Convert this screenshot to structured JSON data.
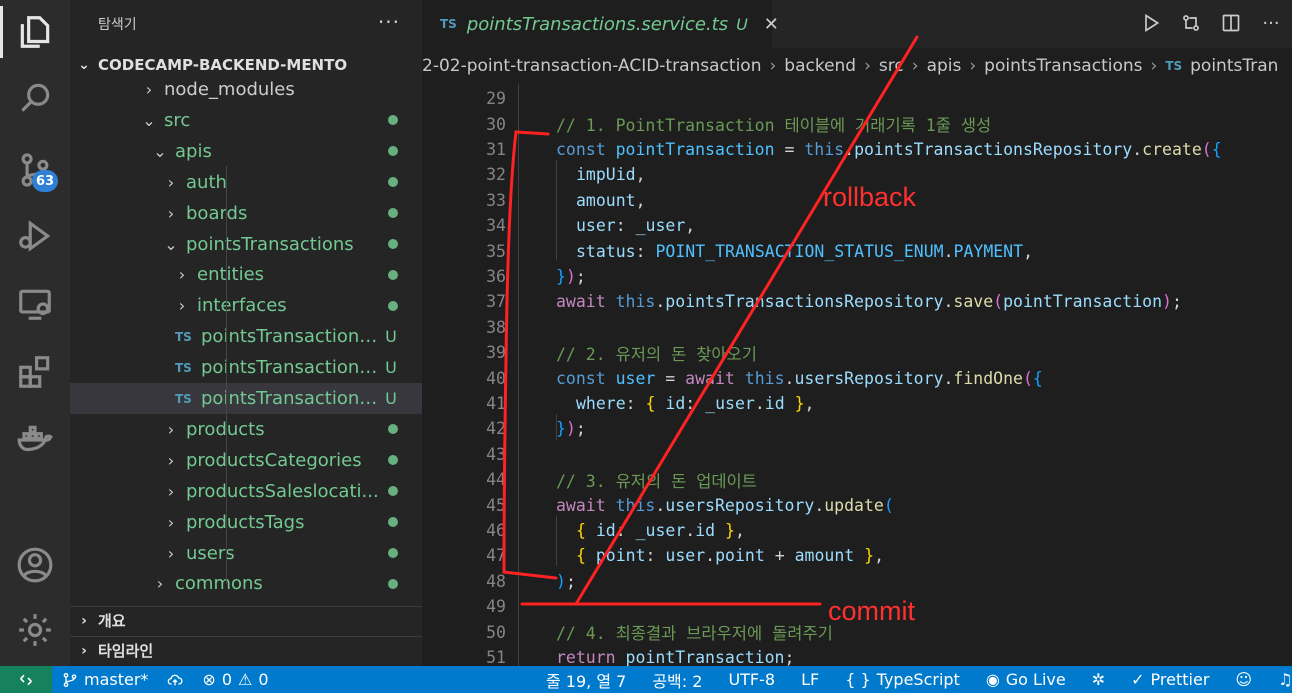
{
  "activity_bar": {
    "items": [
      {
        "name": "explorer",
        "icon": "files-icon",
        "active": true
      },
      {
        "name": "search",
        "icon": "search-icon"
      },
      {
        "name": "source-control",
        "icon": "source-control-icon",
        "badge": "63"
      },
      {
        "name": "run-debug",
        "icon": "run-debug-icon"
      },
      {
        "name": "remote-explorer",
        "icon": "remote-explorer-icon"
      },
      {
        "name": "extensions",
        "icon": "extensions-icon"
      },
      {
        "name": "docker",
        "icon": "docker-icon"
      }
    ],
    "bottom": [
      {
        "name": "accounts",
        "icon": "account-icon"
      },
      {
        "name": "manage",
        "icon": "gear-icon"
      }
    ]
  },
  "sidebar": {
    "title": "탐색기",
    "more": "···",
    "root_label": "CODECAMP-BACKEND-MENTO",
    "tree": [
      {
        "label": "node_modules",
        "chev": "›",
        "level": 1,
        "plain": true
      },
      {
        "label": "src",
        "chev": "⌄",
        "level": 1,
        "dot": true
      },
      {
        "label": "apis",
        "chev": "⌄",
        "level": 2,
        "dot": true
      },
      {
        "label": "auth",
        "chev": "›",
        "level": 3,
        "dot": true
      },
      {
        "label": "boards",
        "chev": "›",
        "level": 3,
        "dot": true
      },
      {
        "label": "pointsTransactions",
        "chev": "⌄",
        "level": 3,
        "dot": true
      },
      {
        "label": "entities",
        "chev": "›",
        "level": 4,
        "dot": true
      },
      {
        "label": "interfaces",
        "chev": "›",
        "level": 4,
        "dot": true
      },
      {
        "label": "pointsTransactions....",
        "ts": "TS",
        "level": 4,
        "mark": "U"
      },
      {
        "label": "pointsTransactions....",
        "ts": "TS",
        "level": 4,
        "mark": "U"
      },
      {
        "label": "pointsTransactions....",
        "ts": "TS",
        "level": 4,
        "mark": "U",
        "selected": true
      },
      {
        "label": "products",
        "chev": "›",
        "level": 3,
        "dot": true
      },
      {
        "label": "productsCategories",
        "chev": "›",
        "level": 3,
        "dot": true
      },
      {
        "label": "productsSaleslocati...",
        "chev": "›",
        "level": 3,
        "dot": true
      },
      {
        "label": "productsTags",
        "chev": "›",
        "level": 3,
        "dot": true
      },
      {
        "label": "users",
        "chev": "›",
        "level": 3,
        "dot": true
      },
      {
        "label": "commons",
        "chev": "›",
        "level": 2,
        "dot": true
      }
    ],
    "outline_label": "개요",
    "timeline_label": "타임라인"
  },
  "editor": {
    "tab": {
      "badge": "TS",
      "name": "pointsTransactions.service.ts",
      "status": "U",
      "close": "✕"
    },
    "breadcrumb": [
      "2-02-point-transaction-ACID-transaction",
      "backend",
      "src",
      "apis",
      "pointsTransactions",
      "pointsTran"
    ],
    "breadcrumb_ts": "TS",
    "more": "···"
  },
  "code_lines": [
    {
      "n": "29",
      "indent": 0,
      "tokens": []
    },
    {
      "n": "30",
      "indent": 0,
      "tokens": [
        [
          "c-com",
          "// 1. PointTransaction 테이블에 거래기록 1줄 생성"
        ]
      ]
    },
    {
      "n": "31",
      "indent": 0,
      "tokens": [
        [
          "c-kw",
          "const "
        ],
        [
          "c-const",
          "pointTransaction"
        ],
        [
          "c-p",
          " = "
        ],
        [
          "c-kw",
          "this"
        ],
        [
          "c-p",
          "."
        ],
        [
          "c-var",
          "pointsTransactionsRepository"
        ],
        [
          "c-p",
          "."
        ],
        [
          "c-fn",
          "create"
        ],
        [
          "c-b2",
          "("
        ],
        [
          "c-b3",
          "{"
        ]
      ]
    },
    {
      "n": "32",
      "indent": 1,
      "tokens": [
        [
          "c-var",
          "impUid"
        ],
        [
          "c-p",
          ","
        ]
      ]
    },
    {
      "n": "33",
      "indent": 1,
      "tokens": [
        [
          "c-var",
          "amount"
        ],
        [
          "c-p",
          ","
        ]
      ]
    },
    {
      "n": "34",
      "indent": 1,
      "tokens": [
        [
          "c-var",
          "user"
        ],
        [
          "c-p",
          ": "
        ],
        [
          "c-var",
          "_user"
        ],
        [
          "c-p",
          ","
        ]
      ]
    },
    {
      "n": "35",
      "indent": 1,
      "tokens": [
        [
          "c-var",
          "status"
        ],
        [
          "c-p",
          ": "
        ],
        [
          "c-const",
          "POINT_TRANSACTION_STATUS_ENUM"
        ],
        [
          "c-p",
          "."
        ],
        [
          "c-const",
          "PAYMENT"
        ],
        [
          "c-p",
          ","
        ]
      ]
    },
    {
      "n": "36",
      "indent": 0,
      "tokens": [
        [
          "c-b3",
          "}"
        ],
        [
          "c-b2",
          ")"
        ],
        [
          "c-p",
          ";"
        ]
      ]
    },
    {
      "n": "37",
      "indent": 0,
      "tokens": [
        [
          "c-ctl",
          "await "
        ],
        [
          "c-kw",
          "this"
        ],
        [
          "c-p",
          "."
        ],
        [
          "c-var",
          "pointsTransactionsRepository"
        ],
        [
          "c-p",
          "."
        ],
        [
          "c-fn",
          "save"
        ],
        [
          "c-b2",
          "("
        ],
        [
          "c-var",
          "pointTransaction"
        ],
        [
          "c-b2",
          ")"
        ],
        [
          "c-p",
          ";"
        ]
      ]
    },
    {
      "n": "38",
      "indent": 0,
      "tokens": []
    },
    {
      "n": "39",
      "indent": 0,
      "tokens": [
        [
          "c-com",
          "// 2. 유저의 돈 찾아오기"
        ]
      ]
    },
    {
      "n": "40",
      "indent": 0,
      "tokens": [
        [
          "c-kw",
          "const "
        ],
        [
          "c-const",
          "user"
        ],
        [
          "c-p",
          " = "
        ],
        [
          "c-ctl",
          "await "
        ],
        [
          "c-kw",
          "this"
        ],
        [
          "c-p",
          "."
        ],
        [
          "c-var",
          "usersRepository"
        ],
        [
          "c-p",
          "."
        ],
        [
          "c-fn",
          "findOne"
        ],
        [
          "c-b2",
          "("
        ],
        [
          "c-b3",
          "{"
        ]
      ]
    },
    {
      "n": "41",
      "indent": 1,
      "tokens": [
        [
          "c-var",
          "where"
        ],
        [
          "c-p",
          ": "
        ],
        [
          "c-b1",
          "{ "
        ],
        [
          "c-var",
          "id"
        ],
        [
          "c-p",
          ": "
        ],
        [
          "c-var",
          "_user"
        ],
        [
          "c-p",
          "."
        ],
        [
          "c-var",
          "id"
        ],
        [
          "c-b1",
          " }"
        ],
        [
          "c-p",
          ","
        ]
      ]
    },
    {
      "n": "42",
      "indent": 0,
      "tokens": [
        [
          "c-b3",
          "}"
        ],
        [
          "c-b2",
          ")"
        ],
        [
          "c-p",
          ";"
        ]
      ]
    },
    {
      "n": "43",
      "indent": 0,
      "tokens": []
    },
    {
      "n": "44",
      "indent": 0,
      "tokens": [
        [
          "c-com",
          "// 3. 유저의 돈 업데이트"
        ]
      ]
    },
    {
      "n": "45",
      "indent": 0,
      "tokens": [
        [
          "c-ctl",
          "await "
        ],
        [
          "c-kw",
          "this"
        ],
        [
          "c-p",
          "."
        ],
        [
          "c-var",
          "usersRepository"
        ],
        [
          "c-p",
          "."
        ],
        [
          "c-fn",
          "update"
        ],
        [
          "c-b3",
          "("
        ]
      ]
    },
    {
      "n": "46",
      "indent": 1,
      "tokens": [
        [
          "c-b1",
          "{ "
        ],
        [
          "c-var",
          "id"
        ],
        [
          "c-p",
          ": "
        ],
        [
          "c-var",
          "_user"
        ],
        [
          "c-p",
          "."
        ],
        [
          "c-var",
          "id"
        ],
        [
          "c-b1",
          " }"
        ],
        [
          "c-p",
          ","
        ]
      ]
    },
    {
      "n": "47",
      "indent": 1,
      "tokens": [
        [
          "c-b1",
          "{ "
        ],
        [
          "c-var",
          "point"
        ],
        [
          "c-p",
          ": "
        ],
        [
          "c-var",
          "user"
        ],
        [
          "c-p",
          "."
        ],
        [
          "c-var",
          "point"
        ],
        [
          "c-p",
          " + "
        ],
        [
          "c-var",
          "amount"
        ],
        [
          "c-b1",
          " }"
        ],
        [
          "c-p",
          ","
        ]
      ]
    },
    {
      "n": "48",
      "indent": 0,
      "tokens": [
        [
          "c-b3",
          ")"
        ],
        [
          "c-p",
          ";"
        ]
      ]
    },
    {
      "n": "49",
      "indent": 0,
      "tokens": []
    },
    {
      "n": "50",
      "indent": 0,
      "tokens": [
        [
          "c-com",
          "// 4. 최종결과 브라우저에 돌려주기"
        ]
      ]
    },
    {
      "n": "51",
      "indent": 0,
      "tokens": [
        [
          "c-ctl",
          "return "
        ],
        [
          "c-var",
          "pointTransaction"
        ],
        [
          "c-p",
          ";"
        ]
      ]
    }
  ],
  "annotations": {
    "rollback": "rollback",
    "commit": "commit",
    "color": "#ff3030"
  },
  "status_bar": {
    "remote_icon": "remote-icon",
    "branch": "master*",
    "errors": "0",
    "warnings": "0",
    "position": "줄 19, 열 7",
    "spaces": "공백: 2",
    "encoding": "UTF-8",
    "eol": "LF",
    "language": "TypeScript",
    "golive": "Go Live",
    "prettier": "Prettier"
  }
}
